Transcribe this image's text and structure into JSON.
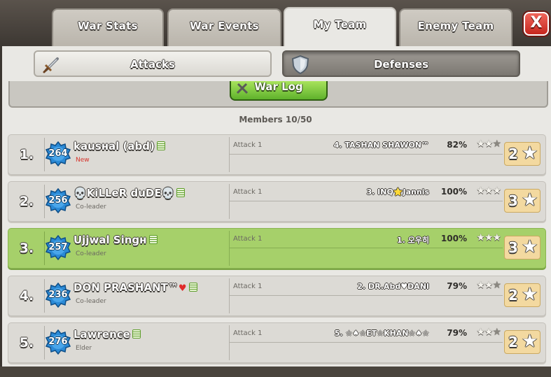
{
  "tabs": [
    {
      "label": "War Stats",
      "active": false
    },
    {
      "label": "War Events",
      "active": false
    },
    {
      "label": "My Team",
      "active": true
    },
    {
      "label": "Enemy Team",
      "active": false
    }
  ],
  "close_label": "X",
  "subtabs": {
    "attacks": {
      "label": "Attacks",
      "icon": "sword-icon",
      "selected": true
    },
    "defenses": {
      "label": "Defenses",
      "icon": "shield-icon",
      "selected": false
    }
  },
  "war_log_label": "War Log",
  "members_label": "Members 10/50",
  "colors": {
    "highlight_row": "#a6d06a",
    "close_button": "#d8372c",
    "war_log_button": "#7cc73c",
    "townhall_badge": "#2b8ad6"
  },
  "members": [
    {
      "rank": "1.",
      "th": "264",
      "name": "kausнal (abd)",
      "role": "New",
      "role_is_new": true,
      "heart": "",
      "attack_label": "Attack 1",
      "target": "4. TASHAN SHAWON™",
      "percent": "82%",
      "stars": 2,
      "total": "2",
      "highlighted": false
    },
    {
      "rank": "2.",
      "th": "256",
      "name": "💀KiLLeR duDE💀",
      "role": "Co-leader",
      "role_is_new": false,
      "heart": "",
      "attack_label": "Attack 1",
      "target": "3. INQ⭐Jannis",
      "percent": "100%",
      "stars": 3,
      "total": "3",
      "highlighted": false
    },
    {
      "rank": "3.",
      "th": "257",
      "name": "Ujjwal Singн",
      "role": "Co-leader",
      "role_is_new": false,
      "heart": "",
      "attack_label": "Attack 1",
      "target": "1. 오우히",
      "percent": "100%",
      "stars": 3,
      "total": "3",
      "highlighted": true
    },
    {
      "rank": "4.",
      "th": "236",
      "name": "DON PRASHANT™",
      "role": "Co-leader",
      "role_is_new": false,
      "heart": "♥",
      "attack_label": "Attack 1",
      "target": "2. DR.Abd♥DANI",
      "percent": "79%",
      "stars": 2,
      "total": "2",
      "highlighted": false
    },
    {
      "rank": "5.",
      "th": "276",
      "name": "Lawrence",
      "role": "Elder",
      "role_is_new": false,
      "heart": "",
      "attack_label": "Attack 1",
      "target": "5. ☆♠☆ET☆KHAN☆♠☆",
      "percent": "79%",
      "stars": 2,
      "total": "2",
      "highlighted": false
    }
  ]
}
